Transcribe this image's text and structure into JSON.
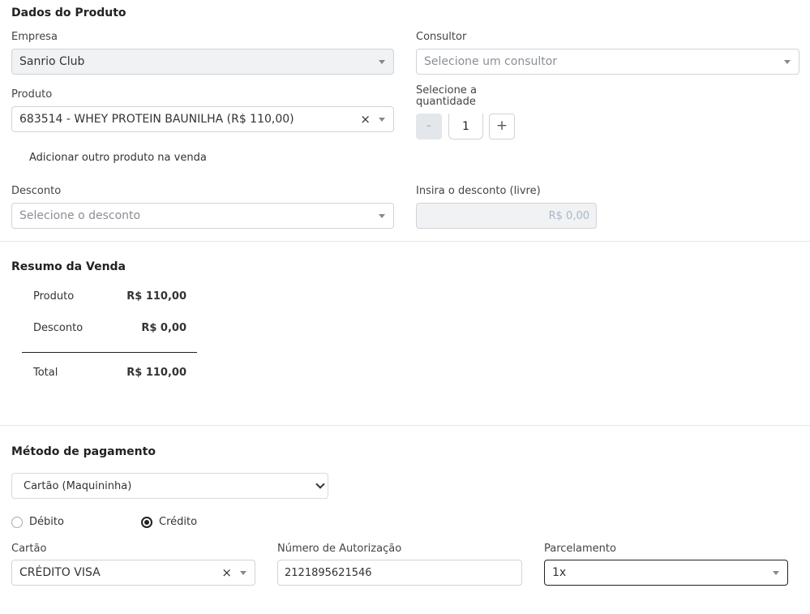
{
  "product_section": {
    "title": "Dados do Produto",
    "empresa": {
      "label": "Empresa",
      "value": "Sanrio Club"
    },
    "consultor": {
      "label": "Consultor",
      "placeholder": "Selecione um consultor"
    },
    "produto": {
      "label": "Produto",
      "value": "683514 - WHEY PROTEIN BAUNILHA (R$ 110,00)",
      "clear": "×"
    },
    "quantidade": {
      "label_line1": "Selecione a",
      "label_line2": "quantidade",
      "minus": "-",
      "value": "1",
      "plus": "+"
    },
    "add_product_link": "Adicionar outro produto na venda",
    "desconto": {
      "label": "Desconto",
      "placeholder": "Selecione o desconto"
    },
    "desconto_livre": {
      "label": "Insira o desconto (livre)",
      "value": "R$ 0,00"
    }
  },
  "summary": {
    "title": "Resumo da Venda",
    "rows": [
      {
        "label": "Produto",
        "value": "R$ 110,00"
      },
      {
        "label": "Desconto",
        "value": "R$ 0,00"
      }
    ],
    "total": {
      "label": "Total",
      "value": "R$ 110,00"
    }
  },
  "payment": {
    "title": "Método de pagamento",
    "method": "Cartão (Maquininha)",
    "radio_debit": "Débito",
    "radio_credit": "Crédito",
    "selected_radio": "credit",
    "cartao": {
      "label": "Cartão",
      "value": "CRÉDITO VISA",
      "clear": "×"
    },
    "autorizacao": {
      "label": "Número de Autorização",
      "value": "2121895621546"
    },
    "parcelamento": {
      "label": "Parcelamento",
      "value": "1x"
    }
  },
  "colors": {
    "divider": "#e6e6e6",
    "field_border": "#cfd4da",
    "disabled_bg": "#f0f2f4",
    "placeholder": "#8a8f96"
  },
  "icons": [
    "caret-down-icon",
    "clear-icon",
    "chevron-down-icon"
  ]
}
